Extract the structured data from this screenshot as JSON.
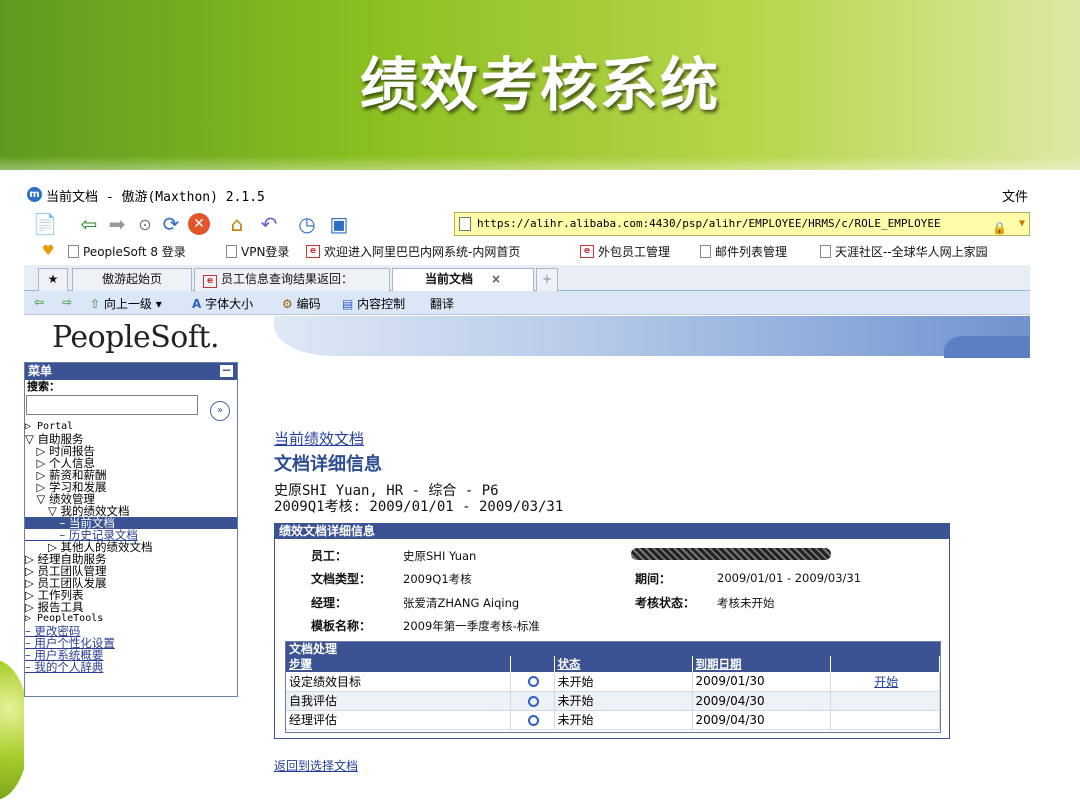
{
  "slide": {
    "title": "绩效考核系统"
  },
  "browser": {
    "window_title": "当前文档 - 傲游(Maxthon) 2.1.5",
    "menu_file": "文件",
    "address": "https://alihr.alibaba.com:4430/psp/alihr/EMPLOYEE/HRMS/c/ROLE_EMPLOYEE",
    "favorites": [
      {
        "label": "PeopleSoft 8 登录"
      },
      {
        "label": "VPN登录"
      },
      {
        "label": "欢迎进入阿里巴巴内网系统-内网首页"
      },
      {
        "label": "外包员工管理"
      },
      {
        "label": "邮件列表管理"
      },
      {
        "label": "天涯社区--全球华人网上家园"
      }
    ],
    "tabs": [
      {
        "label": "傲游起始页"
      },
      {
        "label": "员工信息查询结果返回："
      },
      {
        "label": "当前文档",
        "close": "×"
      }
    ],
    "nav": {
      "up": "向上一级",
      "font_size": "字体大小",
      "encoding": "编码",
      "content_control": "内容控制",
      "translate": "翻译"
    }
  },
  "ps": {
    "logo": "PeopleSoft.",
    "menu": {
      "title": "菜单",
      "collapse": "−",
      "search_label": "搜索：",
      "go": "»",
      "items": [
        {
          "label": "▷ Portal"
        },
        {
          "label": "▽ 自助服务"
        },
        {
          "label": "　▷ 时间报告"
        },
        {
          "label": "　▷ 个人信息"
        },
        {
          "label": "　▷ 薪资和薪酬"
        },
        {
          "label": "　▷ 学习和发展"
        },
        {
          "label": "　▽ 绩效管理"
        },
        {
          "label": "　　▽ 我的绩效文档"
        },
        {
          "label": "　　　– 当前文档"
        },
        {
          "label": "　　　– 历史记录文档"
        },
        {
          "label": "　　▷ 其他人的绩效文档"
        },
        {
          "label": "▷ 经理自助服务"
        },
        {
          "label": "▷ 员工团队管理"
        },
        {
          "label": "▷ 员工团队发展"
        },
        {
          "label": "▷ 工作列表"
        },
        {
          "label": "▷ 报告工具"
        },
        {
          "label": "▷ PeopleTools"
        },
        {
          "label": "– 更改密码"
        },
        {
          "label": "– 用户个性化设置"
        },
        {
          "label": "– 用户系统概要"
        },
        {
          "label": "– 我的个人辞典"
        }
      ]
    },
    "main": {
      "current_link": "当前绩效文档",
      "heading": "文档详细信息",
      "employee_line": "史原SHI Yuan, HR - 综合 - P6",
      "period_line": "2009Q1考核: 2009/01/01 - 2009/03/31",
      "detail": {
        "title": "绩效文档详细信息",
        "employee_label": "员工：",
        "employee_value": "史原SHI Yuan",
        "doc_type_label": "文档类型：",
        "doc_type_value": "2009Q1考核",
        "period_label": "期间：",
        "period_value": "2009/01/01 - 2009/03/31",
        "manager_label": "经理：",
        "manager_value": "张爱清ZHANG Aiqing",
        "status_label": "考核状态：",
        "status_value": "考核未开始",
        "template_label": "模板名称：",
        "template_value": "2009年第一季度考核-标准"
      },
      "processing": {
        "title": "文档处理",
        "columns": {
          "step": "步骤",
          "status": "状态",
          "due": "到期日期"
        },
        "rows": [
          {
            "step": "设定绩效目标",
            "status": "未开始",
            "due": "2009/01/30",
            "action": "开始"
          },
          {
            "step": "自我评估",
            "status": "未开始",
            "due": "2009/04/30",
            "action": ""
          },
          {
            "step": "经理评估",
            "status": "未开始",
            "due": "2009/04/30",
            "action": ""
          }
        ]
      },
      "return_link": "返回到选择文档"
    }
  }
}
